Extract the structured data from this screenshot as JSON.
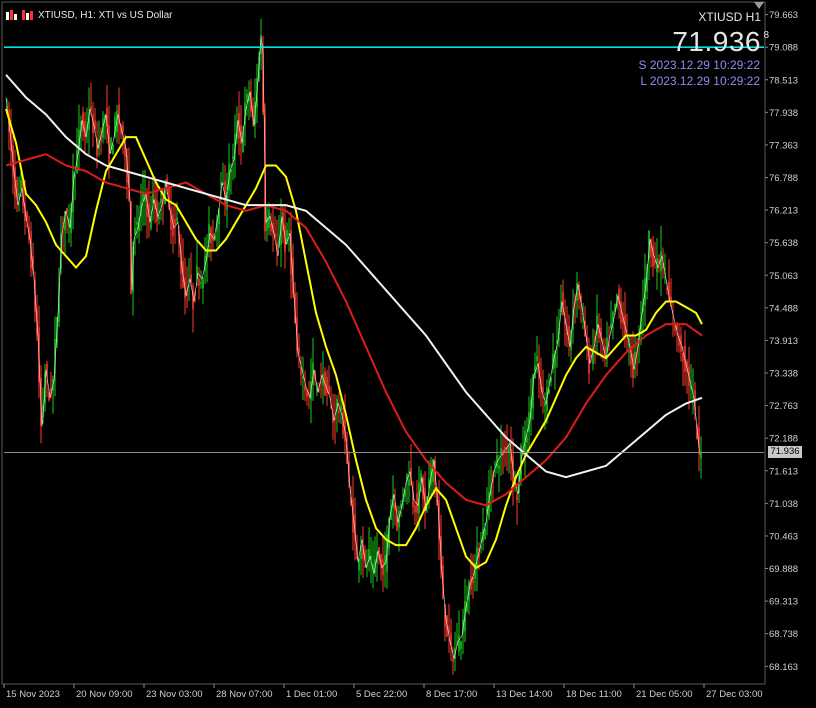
{
  "header": {
    "title": "XTIUSD, H1:  XTI vs US Dollar"
  },
  "info": {
    "symbol_tf": "XTIUSD H1",
    "price_main": "71.93",
    "price_last_digit": "6",
    "price_sup": "8",
    "server_time": "S 2023.12.29 10:29:22",
    "local_time": "L 2023.12.29 10:29:22"
  },
  "chart_data": {
    "type": "candlestick",
    "symbol": "XTIUSD",
    "timeframe": "H1",
    "ylim": [
      67.85,
      79.85
    ],
    "current_price": 71.936,
    "horizontal_line": 79.088,
    "y_ticks": [
      "79.663",
      "79.088",
      "78.513",
      "77.938",
      "77.363",
      "76.788",
      "76.213",
      "75.638",
      "75.063",
      "74.488",
      "73.913",
      "73.338",
      "72.763",
      "72.188",
      "71.613",
      "71.038",
      "70.463",
      "69.888",
      "69.313",
      "68.738",
      "68.163"
    ],
    "x_ticks": [
      "15 Nov 2023",
      "20 Nov 09:00",
      "23 Nov 03:00",
      "28 Nov 07:00",
      "1 Dec 01:00",
      "5 Dec 22:00",
      "8 Dec 17:00",
      "13 Dec 14:00",
      "18 Dec 11:00",
      "21 Dec 05:00",
      "27 Dec 03:00"
    ],
    "price_path": [
      [
        0,
        78.2
      ],
      [
        4,
        77.6
      ],
      [
        8,
        76.9
      ],
      [
        12,
        76.3
      ],
      [
        16,
        76.6
      ],
      [
        20,
        76.1
      ],
      [
        24,
        75.7
      ],
      [
        28,
        75.0
      ],
      [
        32,
        74.0
      ],
      [
        36,
        72.4
      ],
      [
        38,
        72.8
      ],
      [
        40,
        73.4
      ],
      [
        44,
        72.9
      ],
      [
        48,
        73.2
      ],
      [
        52,
        74.4
      ],
      [
        56,
        75.8
      ],
      [
        60,
        76.2
      ],
      [
        64,
        75.9
      ],
      [
        68,
        76.8
      ],
      [
        72,
        77.2
      ],
      [
        76,
        77.8
      ],
      [
        80,
        77.5
      ],
      [
        84,
        78.0
      ],
      [
        88,
        77.7
      ],
      [
        92,
        77.3
      ],
      [
        96,
        77.6
      ],
      [
        100,
        77.9
      ],
      [
        104,
        77.2
      ],
      [
        108,
        77.5
      ],
      [
        112,
        77.9
      ],
      [
        116,
        77.6
      ],
      [
        120,
        77.3
      ],
      [
        124,
        76.4
      ],
      [
        126,
        74.8
      ],
      [
        128,
        75.7
      ],
      [
        132,
        75.9
      ],
      [
        136,
        76.3
      ],
      [
        140,
        76.5
      ],
      [
        144,
        76.0
      ],
      [
        148,
        76.4
      ],
      [
        152,
        76.1
      ],
      [
        156,
        76.3
      ],
      [
        160,
        76.7
      ],
      [
        164,
        76.2
      ],
      [
        168,
        75.9
      ],
      [
        172,
        76.0
      ],
      [
        176,
        75.2
      ],
      [
        180,
        74.7
      ],
      [
        184,
        75.0
      ],
      [
        188,
        74.6
      ],
      [
        192,
        75.1
      ],
      [
        196,
        75.0
      ],
      [
        200,
        75.3
      ],
      [
        204,
        75.8
      ],
      [
        208,
        75.7
      ],
      [
        212,
        76.1
      ],
      [
        216,
        76.7
      ],
      [
        220,
        76.4
      ],
      [
        224,
        76.9
      ],
      [
        228,
        77.1
      ],
      [
        232,
        77.8
      ],
      [
        236,
        77.4
      ],
      [
        240,
        78.0
      ],
      [
        244,
        78.3
      ],
      [
        248,
        77.7
      ],
      [
        252,
        78.5
      ],
      [
        255,
        79.3
      ],
      [
        257,
        79.0
      ],
      [
        260,
        76.0
      ],
      [
        264,
        76.1
      ],
      [
        268,
        75.8
      ],
      [
        272,
        75.4
      ],
      [
        276,
        76.1
      ],
      [
        280,
        75.6
      ],
      [
        284,
        75.8
      ],
      [
        288,
        74.7
      ],
      [
        292,
        73.7
      ],
      [
        296,
        73.4
      ],
      [
        300,
        73.1
      ],
      [
        304,
        72.9
      ],
      [
        308,
        73.4
      ],
      [
        312,
        73.0
      ],
      [
        316,
        73.3
      ],
      [
        320,
        73.1
      ],
      [
        324,
        72.9
      ],
      [
        328,
        72.5
      ],
      [
        332,
        72.8
      ],
      [
        336,
        72.6
      ],
      [
        340,
        72.2
      ],
      [
        344,
        71.3
      ],
      [
        348,
        70.7
      ],
      [
        352,
        70.0
      ],
      [
        356,
        70.4
      ],
      [
        360,
        69.9
      ],
      [
        364,
        70.1
      ],
      [
        368,
        69.8
      ],
      [
        372,
        70.2
      ],
      [
        376,
        69.9
      ],
      [
        380,
        70.0
      ],
      [
        384,
        70.8
      ],
      [
        388,
        71.2
      ],
      [
        392,
        70.7
      ],
      [
        396,
        71.0
      ],
      [
        400,
        71.4
      ],
      [
        404,
        71.6
      ],
      [
        408,
        71.1
      ],
      [
        412,
        71.0
      ],
      [
        416,
        71.5
      ],
      [
        420,
        70.9
      ],
      [
        424,
        71.4
      ],
      [
        428,
        71.8
      ],
      [
        432,
        71.0
      ],
      [
        436,
        69.8
      ],
      [
        440,
        69.0
      ],
      [
        444,
        68.6
      ],
      [
        448,
        68.3
      ],
      [
        452,
        68.6
      ],
      [
        456,
        68.7
      ],
      [
        460,
        69.2
      ],
      [
        464,
        69.6
      ],
      [
        468,
        69.8
      ],
      [
        472,
        70.1
      ],
      [
        476,
        70.4
      ],
      [
        480,
        70.7
      ],
      [
        484,
        71.2
      ],
      [
        488,
        71.6
      ],
      [
        492,
        71.8
      ],
      [
        496,
        71.9
      ],
      [
        500,
        72.0
      ],
      [
        504,
        72.1
      ],
      [
        508,
        71.5
      ],
      [
        512,
        71.2
      ],
      [
        516,
        71.9
      ],
      [
        520,
        72.2
      ],
      [
        524,
        72.5
      ],
      [
        528,
        73.3
      ],
      [
        532,
        73.5
      ],
      [
        536,
        73.0
      ],
      [
        540,
        72.8
      ],
      [
        544,
        73.2
      ],
      [
        548,
        73.6
      ],
      [
        552,
        73.9
      ],
      [
        556,
        74.6
      ],
      [
        560,
        74.2
      ],
      [
        564,
        73.8
      ],
      [
        568,
        74.5
      ],
      [
        572,
        74.9
      ],
      [
        576,
        74.5
      ],
      [
        580,
        74.0
      ],
      [
        584,
        73.5
      ],
      [
        588,
        73.8
      ],
      [
        592,
        74.2
      ],
      [
        596,
        73.9
      ],
      [
        600,
        73.6
      ],
      [
        604,
        74.0
      ],
      [
        608,
        74.3
      ],
      [
        612,
        74.7
      ],
      [
        616,
        74.4
      ],
      [
        620,
        74.1
      ],
      [
        624,
        73.8
      ],
      [
        628,
        73.4
      ],
      [
        632,
        73.8
      ],
      [
        636,
        74.4
      ],
      [
        640,
        74.9
      ],
      [
        644,
        75.7
      ],
      [
        648,
        75.4
      ],
      [
        652,
        75.2
      ],
      [
        656,
        75.4
      ],
      [
        660,
        75.0
      ],
      [
        664,
        74.6
      ],
      [
        668,
        74.3
      ],
      [
        672,
        74.0
      ],
      [
        676,
        73.8
      ],
      [
        680,
        73.5
      ],
      [
        684,
        73.2
      ],
      [
        688,
        72.9
      ],
      [
        692,
        72.2
      ],
      [
        694,
        71.9
      ]
    ],
    "series": [
      {
        "name": "",
        "color": "#ffff00",
        "values": [
          [
            0,
            78.0
          ],
          [
            10,
            77.4
          ],
          [
            20,
            76.5
          ],
          [
            30,
            76.3
          ],
          [
            40,
            76.0
          ],
          [
            50,
            75.6
          ],
          [
            60,
            75.4
          ],
          [
            70,
            75.2
          ],
          [
            80,
            75.4
          ],
          [
            90,
            76.2
          ],
          [
            100,
            76.9
          ],
          [
            110,
            77.2
          ],
          [
            120,
            77.5
          ],
          [
            130,
            77.5
          ],
          [
            140,
            77.1
          ],
          [
            150,
            76.7
          ],
          [
            160,
            76.4
          ],
          [
            170,
            76.3
          ],
          [
            180,
            76.0
          ],
          [
            190,
            75.7
          ],
          [
            200,
            75.5
          ],
          [
            210,
            75.5
          ],
          [
            220,
            75.7
          ],
          [
            230,
            76.0
          ],
          [
            240,
            76.3
          ],
          [
            250,
            76.6
          ],
          [
            260,
            77.0
          ],
          [
            270,
            77.0
          ],
          [
            280,
            76.8
          ],
          [
            290,
            76.2
          ],
          [
            300,
            75.3
          ],
          [
            310,
            74.4
          ],
          [
            320,
            73.8
          ],
          [
            330,
            73.3
          ],
          [
            340,
            72.6
          ],
          [
            350,
            71.8
          ],
          [
            360,
            71.1
          ],
          [
            370,
            70.6
          ],
          [
            380,
            70.4
          ],
          [
            390,
            70.3
          ],
          [
            400,
            70.3
          ],
          [
            410,
            70.6
          ],
          [
            420,
            71.0
          ],
          [
            430,
            71.3
          ],
          [
            440,
            71.1
          ],
          [
            450,
            70.6
          ],
          [
            460,
            70.1
          ],
          [
            470,
            69.9
          ],
          [
            480,
            70.0
          ],
          [
            490,
            70.4
          ],
          [
            500,
            71.0
          ],
          [
            510,
            71.5
          ],
          [
            520,
            71.9
          ],
          [
            530,
            72.2
          ],
          [
            540,
            72.5
          ],
          [
            550,
            72.9
          ],
          [
            560,
            73.3
          ],
          [
            570,
            73.6
          ],
          [
            580,
            73.8
          ],
          [
            590,
            73.7
          ],
          [
            600,
            73.6
          ],
          [
            610,
            73.8
          ],
          [
            620,
            74.0
          ],
          [
            630,
            74.0
          ],
          [
            640,
            74.1
          ],
          [
            650,
            74.4
          ],
          [
            660,
            74.6
          ],
          [
            670,
            74.6
          ],
          [
            680,
            74.5
          ],
          [
            690,
            74.4
          ],
          [
            696,
            74.2
          ]
        ]
      },
      {
        "name": "",
        "color": "#dd1c1c",
        "values": [
          [
            0,
            77.0
          ],
          [
            20,
            77.1
          ],
          [
            40,
            77.2
          ],
          [
            60,
            77.0
          ],
          [
            80,
            76.9
          ],
          [
            100,
            76.7
          ],
          [
            120,
            76.6
          ],
          [
            140,
            76.5
          ],
          [
            160,
            76.6
          ],
          [
            180,
            76.7
          ],
          [
            200,
            76.5
          ],
          [
            220,
            76.3
          ],
          [
            240,
            76.2
          ],
          [
            260,
            76.3
          ],
          [
            280,
            76.2
          ],
          [
            300,
            75.9
          ],
          [
            320,
            75.3
          ],
          [
            340,
            74.6
          ],
          [
            360,
            73.8
          ],
          [
            380,
            73.0
          ],
          [
            400,
            72.3
          ],
          [
            420,
            71.8
          ],
          [
            440,
            71.4
          ],
          [
            460,
            71.1
          ],
          [
            480,
            71.0
          ],
          [
            500,
            71.2
          ],
          [
            520,
            71.5
          ],
          [
            540,
            71.8
          ],
          [
            560,
            72.2
          ],
          [
            580,
            72.8
          ],
          [
            600,
            73.3
          ],
          [
            620,
            73.7
          ],
          [
            640,
            74.0
          ],
          [
            660,
            74.2
          ],
          [
            680,
            74.2
          ],
          [
            696,
            74.0
          ]
        ]
      },
      {
        "name": "",
        "color": "#f2f2f2",
        "values": [
          [
            0,
            78.6
          ],
          [
            20,
            78.2
          ],
          [
            40,
            77.9
          ],
          [
            60,
            77.5
          ],
          [
            80,
            77.2
          ],
          [
            100,
            77.0
          ],
          [
            120,
            76.9
          ],
          [
            140,
            76.8
          ],
          [
            160,
            76.7
          ],
          [
            180,
            76.6
          ],
          [
            200,
            76.5
          ],
          [
            220,
            76.4
          ],
          [
            240,
            76.3
          ],
          [
            260,
            76.3
          ],
          [
            280,
            76.3
          ],
          [
            300,
            76.2
          ],
          [
            320,
            75.9
          ],
          [
            340,
            75.6
          ],
          [
            360,
            75.2
          ],
          [
            380,
            74.8
          ],
          [
            400,
            74.4
          ],
          [
            420,
            74.0
          ],
          [
            440,
            73.5
          ],
          [
            460,
            73.0
          ],
          [
            480,
            72.6
          ],
          [
            500,
            72.2
          ],
          [
            520,
            71.9
          ],
          [
            540,
            71.6
          ],
          [
            560,
            71.5
          ],
          [
            580,
            71.6
          ],
          [
            600,
            71.7
          ],
          [
            620,
            72.0
          ],
          [
            640,
            72.3
          ],
          [
            660,
            72.6
          ],
          [
            680,
            72.8
          ],
          [
            696,
            72.9
          ]
        ]
      }
    ]
  }
}
